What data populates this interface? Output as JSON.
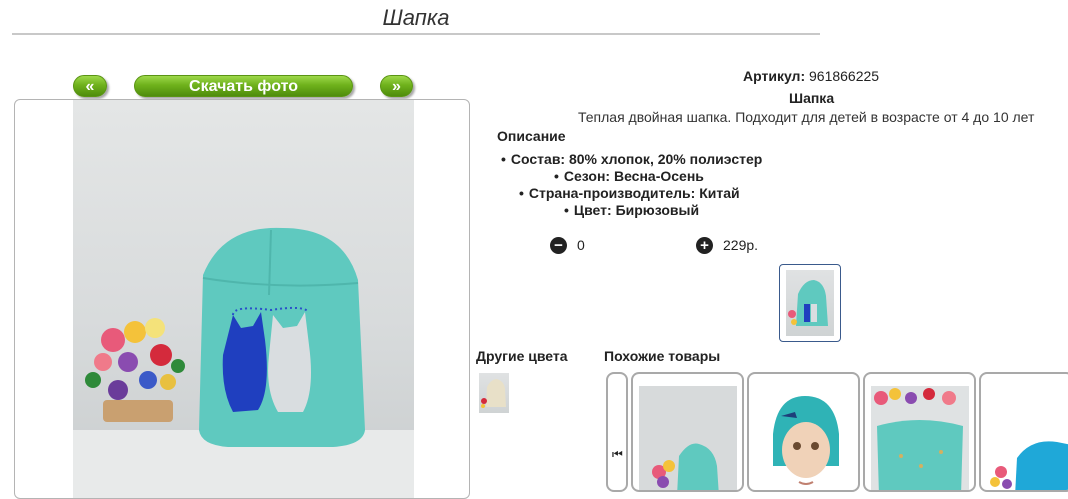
{
  "page": {
    "title": "Шапка"
  },
  "gallery": {
    "prev_label": "«",
    "download_label": "Скачать фото",
    "next_label": "»"
  },
  "product": {
    "sku_label": "Артикул:",
    "sku_value": "961866225",
    "name": "Шапка",
    "short_description": "Теплая двойная шапка. Подходит для детей в возрасте от 4 до 10 лет",
    "description_heading": "Описание",
    "specs": [
      "Состав: 80% хлопок, 20% полиэстер",
      "Сезон: Весна-Осень",
      "Страна-производитель: Китай",
      "Цвет: Бирюзовый"
    ]
  },
  "cart": {
    "minus_icon": "−",
    "quantity": "0",
    "plus_icon": "+",
    "price": "229р."
  },
  "sections": {
    "other_colors": "Другие цвета",
    "similar_products": "Похожие товары"
  },
  "carousel": {
    "prev_icon": "⏮"
  },
  "colors": {
    "accent_green": "#6fb21c",
    "hat_turquoise": "#5fc9bf",
    "thumb_border": "#3a5a8c"
  }
}
